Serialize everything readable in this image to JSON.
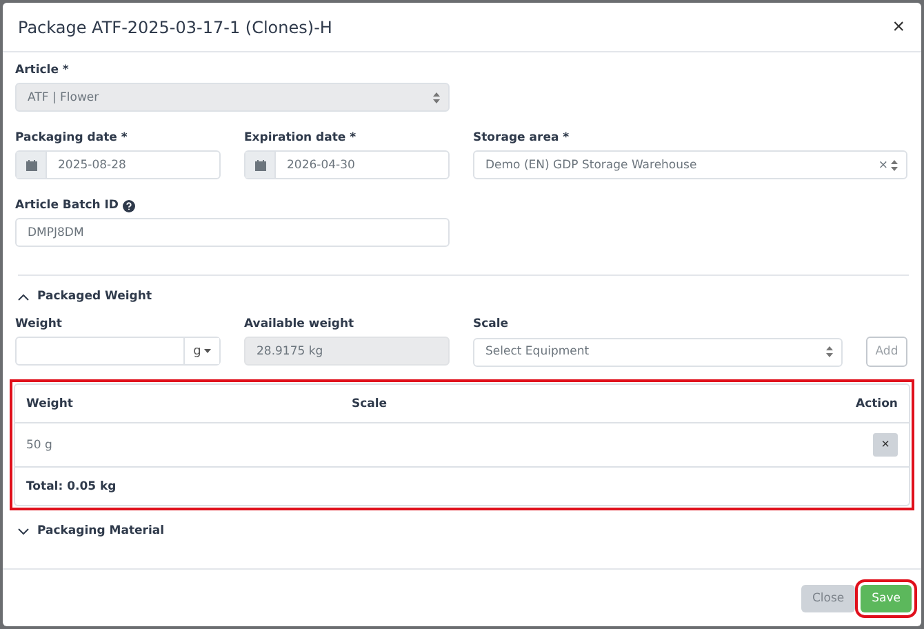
{
  "modal": {
    "title": "Package ATF-2025-03-17-1 (Clones)-H",
    "close_icon": "×"
  },
  "article": {
    "label": "Article",
    "required_mark": "*",
    "value": "ATF | Flower",
    "disabled": true
  },
  "packaging_date": {
    "label": "Packaging date",
    "required_mark": "*",
    "value": "2025-08-28"
  },
  "expiration_date": {
    "label": "Expiration date",
    "required_mark": "*",
    "value": "2026-04-30"
  },
  "storage_area": {
    "label": "Storage area",
    "required_mark": "*",
    "value": "Demo (EN) GDP Storage Warehouse",
    "clear": "×"
  },
  "batch_id": {
    "label": "Article Batch ID",
    "value": "DMPJ8DM"
  },
  "sections": [
    {
      "title": "Packaged Weight",
      "expanded": true
    },
    {
      "title": "Packaging Material",
      "expanded": false
    }
  ],
  "weight_form": {
    "weight_label": "Weight",
    "unit": "g",
    "available_label": "Available weight",
    "available_value": "28.9175 kg",
    "scale_label": "Scale",
    "scale_placeholder": "Select Equipment",
    "add_button": "Add"
  },
  "table": {
    "highlighted": true,
    "columns": [
      "Weight",
      "Scale",
      "Action"
    ],
    "rows": [
      {
        "weight": "50 g",
        "remove": "×"
      }
    ],
    "total": "Total: 0.05 kg"
  },
  "footer": {
    "buttons": [
      {
        "label": "Close",
        "kind": "secondary",
        "highlighted": false
      },
      {
        "label": "Save",
        "kind": "primary",
        "highlighted": true
      }
    ]
  }
}
